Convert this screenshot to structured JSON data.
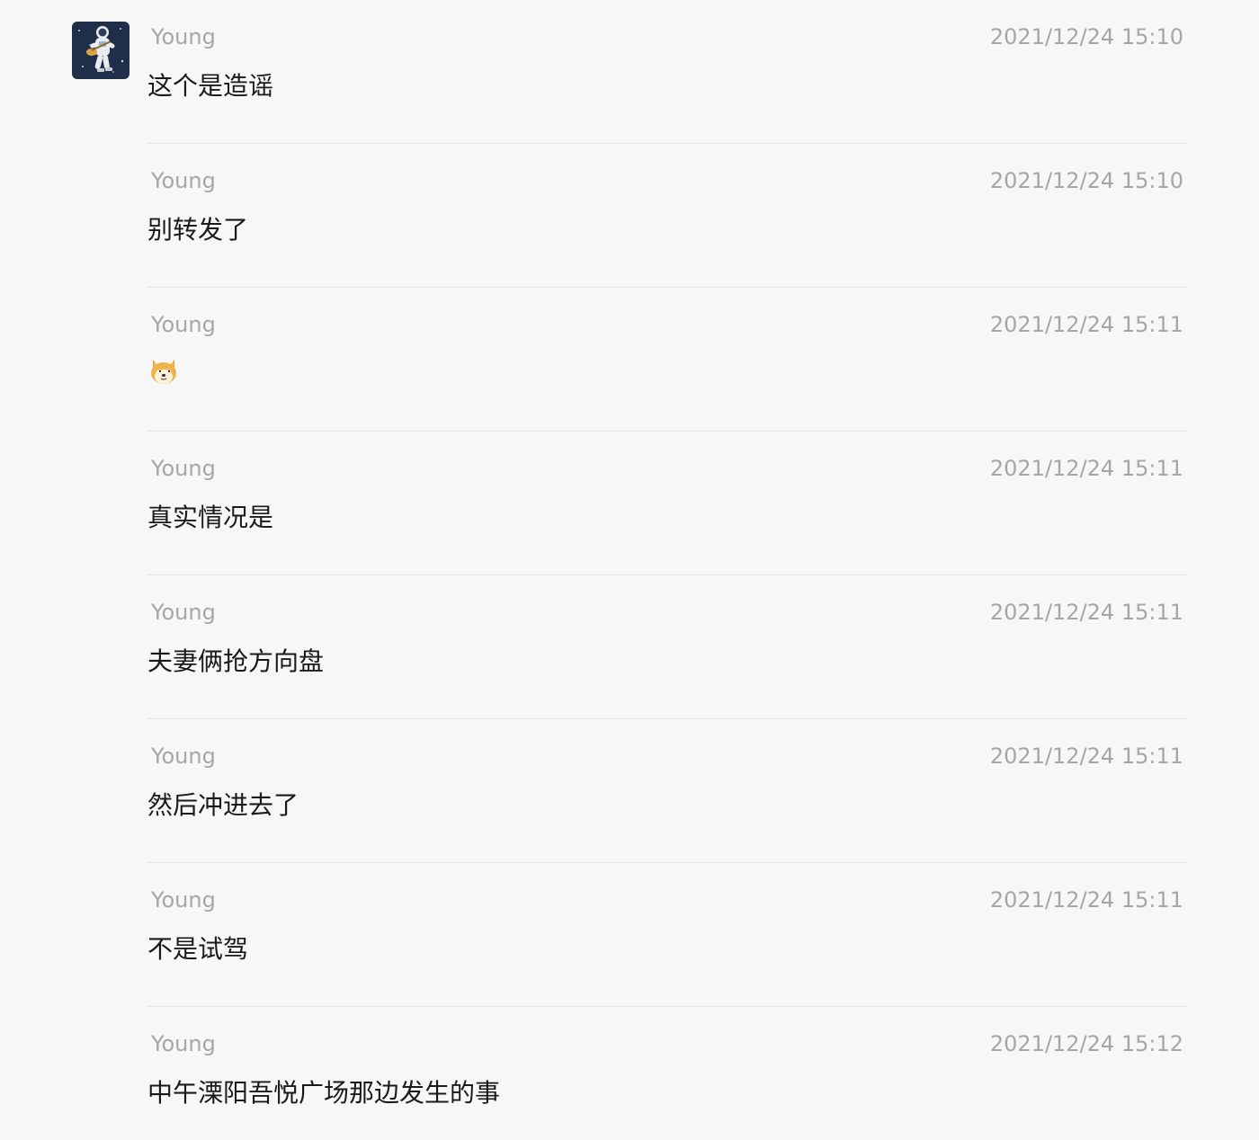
{
  "messages": [
    {
      "sender": "Young",
      "time": "2021/12/24 15:10",
      "text": "这个是造谣"
    },
    {
      "sender": "Young",
      "time": "2021/12/24 15:10",
      "text": "别转发了"
    },
    {
      "sender": "Young",
      "time": "2021/12/24 15:11",
      "sticker": "doge-emoji-icon"
    },
    {
      "sender": "Young",
      "time": "2021/12/24 15:11",
      "text": "真实情况是"
    },
    {
      "sender": "Young",
      "time": "2021/12/24 15:11",
      "text": "夫妻俩抢方向盘"
    },
    {
      "sender": "Young",
      "time": "2021/12/24 15:11",
      "text": "然后冲进去了"
    },
    {
      "sender": "Young",
      "time": "2021/12/24 15:11",
      "text": "不是试驾"
    },
    {
      "sender": "Young",
      "time": "2021/12/24 15:12",
      "text": "中午溧阳吾悦广场那边发生的事"
    }
  ],
  "colors": {
    "background": "#f7f7f7",
    "meta_text": "#a6a6a6",
    "message_text": "#1a1a1a",
    "divider": "#e6e6e6"
  }
}
